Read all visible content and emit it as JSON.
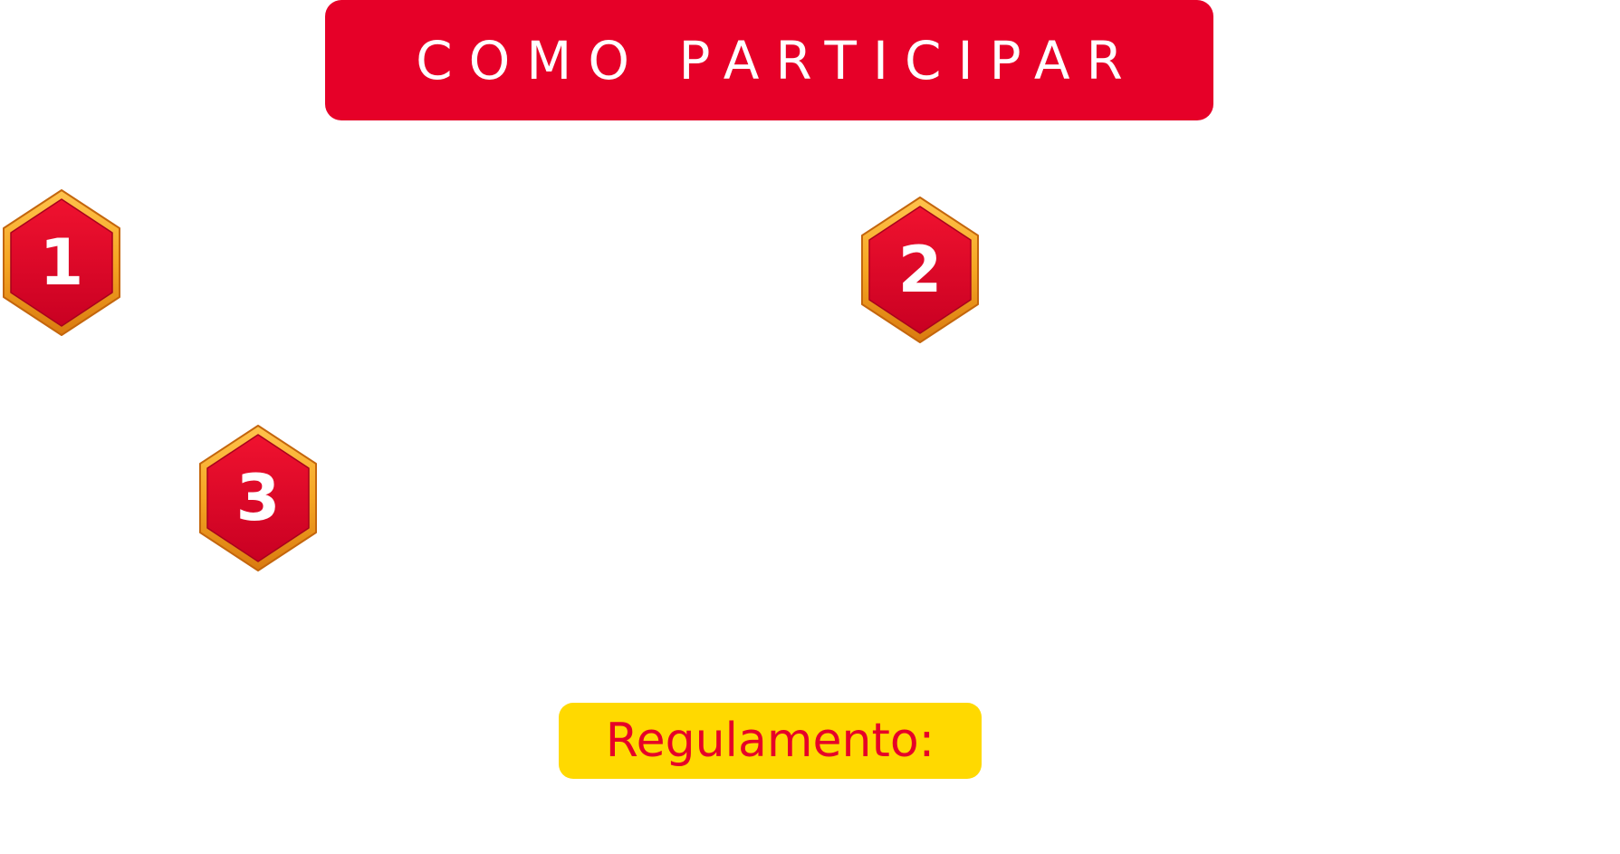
{
  "header": {
    "title": "COMO PARTICIPAR"
  },
  "steps": [
    {
      "number": "1",
      "icon": "hexagon-badge-icon"
    },
    {
      "number": "2",
      "icon": "hexagon-badge-icon"
    },
    {
      "number": "3",
      "icon": "hexagon-badge-icon"
    }
  ],
  "rules": {
    "label": "Regulamento:"
  },
  "colors": {
    "primary_red": "#e60028",
    "accent_yellow": "#ffd900",
    "badge_gold": "#f5a623",
    "text_white": "#ffffff"
  }
}
